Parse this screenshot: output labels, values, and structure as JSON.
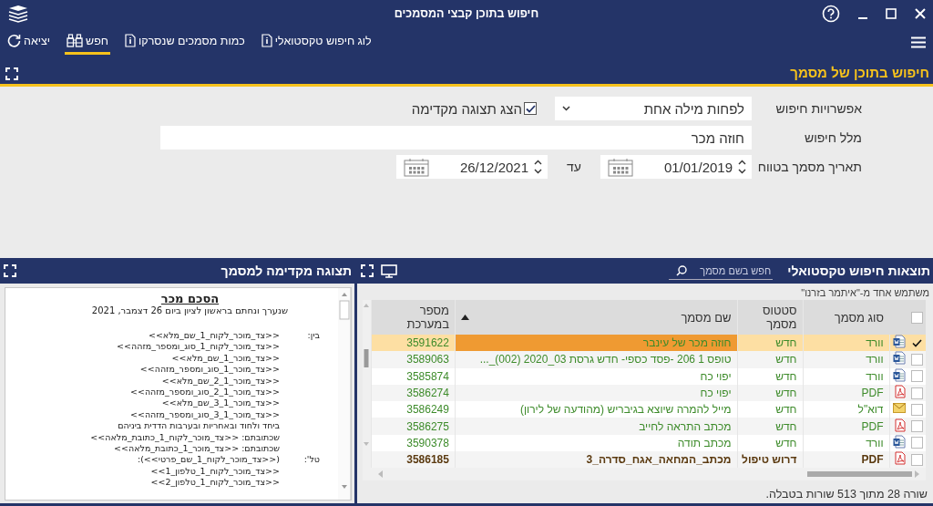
{
  "window": {
    "title": "חיפוש בתוכן קבצי המסמכים"
  },
  "toolbar": [
    {
      "label": "לוג חיפוש טקסטואלי",
      "kind": "info",
      "selected": false
    },
    {
      "label": "כמות מסמכים שנסרקו",
      "kind": "info",
      "selected": false
    },
    {
      "label": "חפש",
      "kind": "binoculars",
      "selected": true
    },
    {
      "label": "יציאה",
      "kind": "exit",
      "selected": false
    }
  ],
  "section": {
    "title": "חיפוש בתוכן של מסמך"
  },
  "form": {
    "options_label": "אפשרויות חיפוש",
    "options_value": "לפחות מילה אחת",
    "show_preview": {
      "label": "הצג תצוגה מקדימה",
      "checked": true
    },
    "text_label": "מלל חיפוש",
    "text_value": "חוזה מכר",
    "date_label": "תאריך מסמך בטווח",
    "date_from": "01/01/2019",
    "to_label": "עד",
    "date_to": "26/12/2021"
  },
  "results": {
    "title": "תוצאות חיפוש טקסטואלי",
    "search_placeholder": "חפש בשם מסמך",
    "note": "משתמש אחד מ-\"איתמר בזרנו\"",
    "select_all": false,
    "columns": [
      {
        "label": "סוג מסמך",
        "sorted": false
      },
      {
        "label": "סטטוס מסמך",
        "sorted": false
      },
      {
        "label": "שם מסמך",
        "sorted": true
      },
      {
        "label": "מספר במערכת",
        "sorted": false
      }
    ],
    "rows": [
      {
        "checked": true,
        "selected": true,
        "kind": "word",
        "type": "וורד",
        "status": "חדש",
        "name": "חוזה מכר של עינבר",
        "number": "3591622",
        "emphasized": false
      },
      {
        "checked": false,
        "selected": false,
        "kind": "word",
        "type": "וורד",
        "status": "חדש",
        "name": "טופס 1 206 -פסד כספי- חדש גרסת 03_2020 (002)_...",
        "number": "3589063",
        "emphasized": false
      },
      {
        "checked": false,
        "selected": false,
        "kind": "word",
        "type": "וורד",
        "status": "חדש",
        "name": "יפוי כח",
        "number": "3585874",
        "emphasized": false
      },
      {
        "checked": false,
        "selected": false,
        "kind": "pdf",
        "type": "PDF",
        "status": "חדש",
        "name": "יפוי כח",
        "number": "3586274",
        "emphasized": false
      },
      {
        "checked": false,
        "selected": false,
        "kind": "mail",
        "type": "דוא\"ל",
        "status": "חדש",
        "name": "מייל להמרה שיוצא בגיבריש (מהודעה של לירון)",
        "number": "3586249",
        "emphasized": false
      },
      {
        "checked": false,
        "selected": false,
        "kind": "pdf",
        "type": "PDF",
        "status": "חדש",
        "name": "מכתב התראה לחייב",
        "number": "3586275",
        "emphasized": false
      },
      {
        "checked": false,
        "selected": false,
        "kind": "word",
        "type": "וורד",
        "status": "חדש",
        "name": "מכתב תודה",
        "number": "3590378",
        "emphasized": false
      },
      {
        "checked": false,
        "selected": false,
        "kind": "pdf",
        "type": "PDF",
        "status": "דרוש טיפול",
        "name": "מכתב_המחאה_אגח_סדרה_3",
        "number": "3586185",
        "emphasized": true
      }
    ],
    "status": "שורה 28 מתוך 513 שורות בטבלה."
  },
  "preview": {
    "title": "תצוגה מקדימה למסמך",
    "doc_title": "הסכם מכר",
    "doc_subtitle": "שנערך ונחתם בראשון לציון ביום 26 דצמבר, 2021",
    "lines": [
      {
        "label": "בין:",
        "text": "<<צד_מוכר_לקוח_1_שם_מלא>>"
      },
      {
        "text": "<<צד_מוכר_לקוח_1_סוג_ומספר_מזהה>>"
      },
      {
        "text": "<<צד_מוכר_1_שם_מלא>>"
      },
      {
        "text": "<<צד_מוכר_1_סוג_ומספר_מזהה>>"
      },
      {
        "text": "<<צד_מוכר_1_2_שם_מלא>>"
      },
      {
        "text": "<<צד_מוכר_1_2_סוג_ומספר_מזהה>>"
      },
      {
        "text": "<<צד_מוכר_1_3_שם_מלא>>"
      },
      {
        "text": "<<צד_מוכר_1_3_סוג_ומספר_מזהה>>"
      },
      {
        "text": "ביחד ולחוד ובאחריות ובערבות הדדית ביניהם"
      },
      {
        "text": "שכתובתם: <<צד_מוכר_לקוח_1_כתובת_מלאה>>"
      },
      {
        "text": "שכתובתם: <<צד_מוכר_1_כתובת_מלאה>>"
      },
      {
        "label": "טל':",
        "text": "(<<צד_מוכר_לקוח_1_שם_פרטי>>):"
      },
      {
        "text": "<<צד_מוכר_לקוח_1_טלפון_1>>"
      },
      {
        "text": "<<צד_מוכר_לקוח_1_טלפון_2>>"
      }
    ]
  }
}
